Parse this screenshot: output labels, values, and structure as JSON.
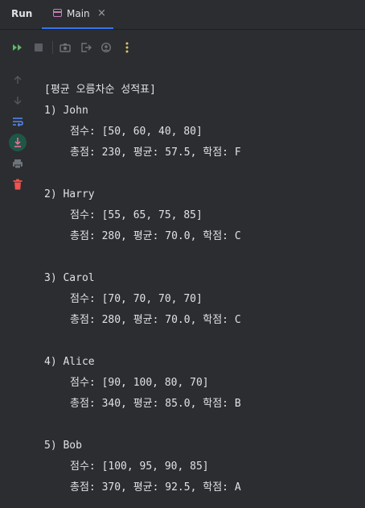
{
  "run_panel": {
    "title": "Run",
    "tab": {
      "label": "Main",
      "close": "×"
    }
  },
  "toolbar": {
    "icons": [
      "rerun-icon",
      "stop-icon",
      "camera-icon",
      "exit-icon",
      "settings-icon",
      "more-icon"
    ]
  },
  "sidebar": {
    "icons": [
      "arrow-up-icon",
      "arrow-down-icon",
      "soft-wrap-icon",
      "scroll-to-end-icon",
      "print-icon",
      "trash-icon"
    ]
  },
  "console": {
    "header": "[평균 오름차순 성적표]",
    "students": [
      {
        "name_line": "1) John",
        "scores_line": "점수: [50, 60, 40, 80]",
        "summary_line": "총점: 230, 평균: 57.5, 학점: F"
      },
      {
        "name_line": "2) Harry",
        "scores_line": "점수: [55, 65, 75, 85]",
        "summary_line": "총점: 280, 평균: 70.0, 학점: C"
      },
      {
        "name_line": "3) Carol",
        "scores_line": "점수: [70, 70, 70, 70]",
        "summary_line": "총점: 280, 평균: 70.0, 학점: C"
      },
      {
        "name_line": "4) Alice",
        "scores_line": "점수: [90, 100, 80, 70]",
        "summary_line": "총점: 340, 평균: 85.0, 학점: B"
      },
      {
        "name_line": "5) Bob",
        "scores_line": "점수: [100, 95, 90, 85]",
        "summary_line": "총점: 370, 평균: 92.5, 학점: A"
      }
    ]
  }
}
